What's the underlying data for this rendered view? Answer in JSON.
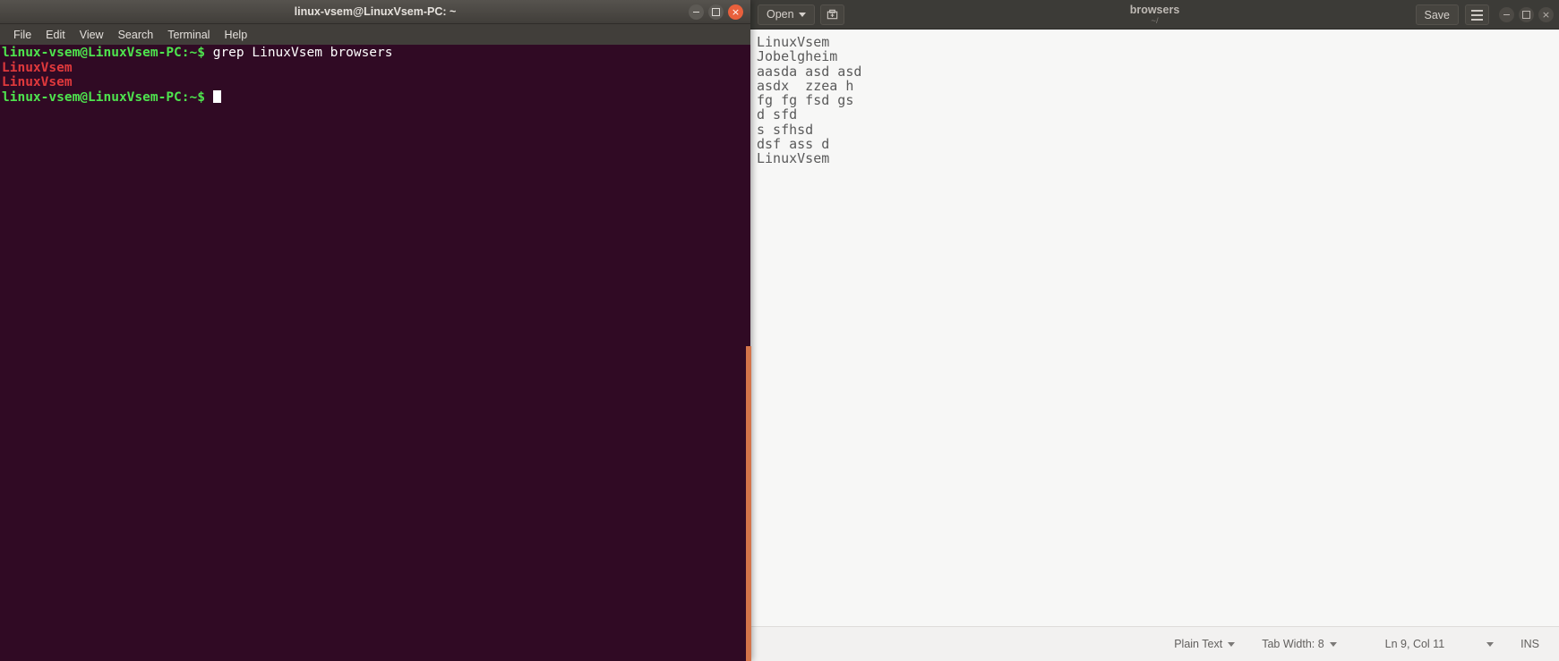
{
  "terminal": {
    "title": "linux-vsem@LinuxVsem-PC: ~",
    "menu": [
      {
        "label": "File"
      },
      {
        "label": "Edit"
      },
      {
        "label": "View"
      },
      {
        "label": "Search"
      },
      {
        "label": "Terminal"
      },
      {
        "label": "Help"
      }
    ],
    "window_controls": {
      "minimize": "minimize-icon",
      "maximize": "maximize-icon",
      "close": "×"
    },
    "lines": [
      {
        "prompt": "linux-vsem@LinuxVsem-PC:~$",
        "command": " grep LinuxVsem browsers",
        "type": "command"
      },
      {
        "text": "LinuxVsem",
        "type": "match"
      },
      {
        "text": "LinuxVsem",
        "type": "match"
      },
      {
        "prompt": "linux-vsem@LinuxVsem-PC:~$",
        "command": " ",
        "type": "prompt-cursor"
      }
    ],
    "colors": {
      "background": "#300a24",
      "prompt": "#4ee44e",
      "match": "#e0393c",
      "command": "#ffffff",
      "titlebar": "#413e3a",
      "edge_highlight": "#d4744a"
    }
  },
  "gedit": {
    "open_button": "Open",
    "new_doc_icon": "new-document-icon",
    "title": "browsers",
    "subtitle": "~/",
    "save_button": "Save",
    "menu_icon": "hamburger-menu-icon",
    "window_controls": {
      "minimize": "minimize-icon",
      "maximize": "maximize-icon",
      "close": "×"
    },
    "document_text": "LinuxVsem\nJobelgheim\naasda asd asd\nasdx  zzea h\nfg fg fsd gs\nd sfd\ns sfhsd\ndsf ass d\nLinuxVsem",
    "status_bar": {
      "language": "Plain Text",
      "tab_width": "Tab Width: 8",
      "cursor_position": "Ln 9, Col 11",
      "insert_mode": "INS"
    },
    "colors": {
      "background": "#f7f7f6",
      "headerbar": "#3c3b37",
      "text": "#5a5a5a"
    }
  }
}
